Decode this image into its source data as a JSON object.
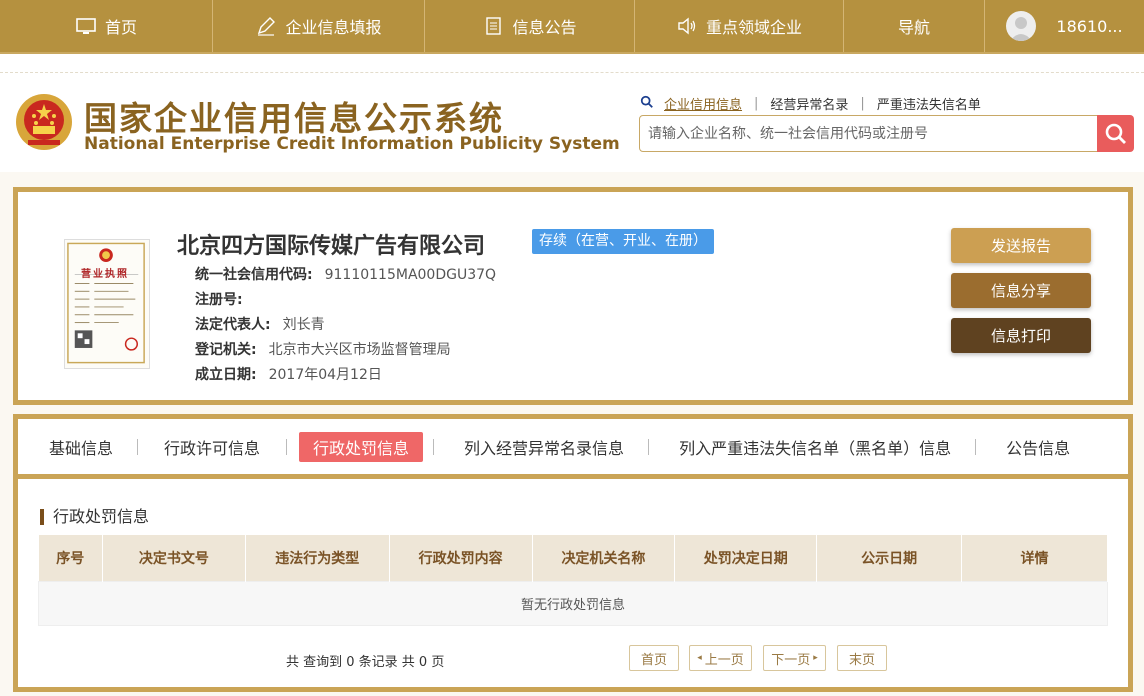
{
  "topnav": {
    "items": [
      {
        "label": "首页",
        "icon": "monitor-icon"
      },
      {
        "label": "企业信息填报",
        "icon": "edit-icon"
      },
      {
        "label": "信息公告",
        "icon": "document-icon"
      },
      {
        "label": "重点领域企业",
        "icon": "speaker-icon"
      },
      {
        "label": "导航",
        "icon": ""
      }
    ],
    "user": "18610..."
  },
  "header": {
    "title_cn": "国家企业信用信息公示系统",
    "title_en": "National Enterprise Credit Information Publicity System",
    "quick_links": [
      "企业信用信息",
      "经营异常名录",
      "严重违法失信名单"
    ],
    "search_placeholder": "请输入企业名称、统一社会信用代码或注册号"
  },
  "company": {
    "name": "北京四方国际传媒广告有限公司",
    "status": "存续（在营、开业、在册）",
    "license_caption": "营业执照",
    "fields": [
      {
        "key": "统一社会信用代码:",
        "value": "91110115MA00DGU37Q"
      },
      {
        "key": "注册号:",
        "value": ""
      },
      {
        "key": "法定代表人:",
        "value": "刘长青"
      },
      {
        "key": "登记机关:",
        "value": "北京市大兴区市场监督管理局"
      },
      {
        "key": "成立日期:",
        "value": "2017年04月12日"
      }
    ],
    "buttons": [
      "发送报告",
      "信息分享",
      "信息打印"
    ]
  },
  "tabs": {
    "items": [
      "基础信息",
      "行政许可信息",
      "行政处罚信息",
      "列入经营异常名录信息",
      "列入严重违法失信名单（黑名单）信息",
      "公告信息"
    ],
    "active": "行政处罚信息"
  },
  "penalty": {
    "section_title": "行政处罚信息",
    "columns": [
      "序号",
      "决定书文号",
      "违法行为类型",
      "行政处罚内容",
      "决定机关名称",
      "处罚决定日期",
      "公示日期",
      "详情"
    ],
    "empty_text": "暂无行政处罚信息",
    "record_count": "共 查询到 0 条记录 共 0 页",
    "pager": [
      "首页",
      "上一页",
      "下一页",
      "末页"
    ]
  },
  "colors": {
    "gold": "#b5913f",
    "brown_title": "#8a6320",
    "badge_blue": "#4a9be8",
    "tab_active": "#ef6767",
    "btn_send": "#cc9f52",
    "btn_share": "#9b6d2f",
    "btn_print": "#5f4220"
  }
}
